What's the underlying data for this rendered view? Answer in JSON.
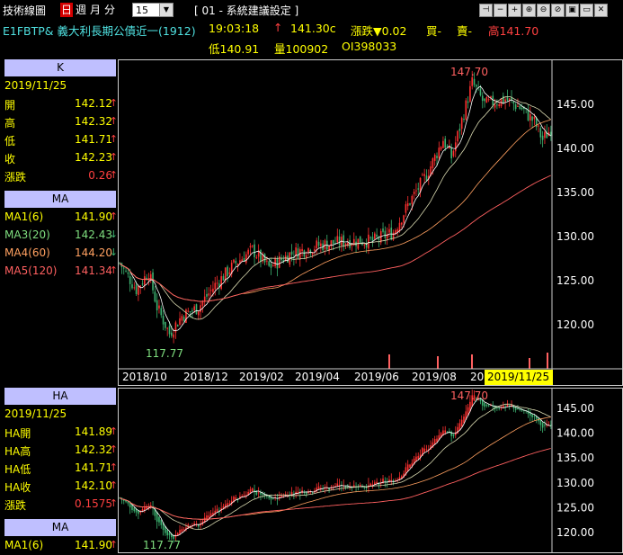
{
  "toolbar": {
    "title": "技術線圖",
    "tabs": [
      {
        "label": "日",
        "active": true
      },
      {
        "label": "週",
        "active": false
      },
      {
        "label": "月",
        "active": false
      },
      {
        "label": "分",
        "active": false
      }
    ],
    "interval": "15",
    "setting": "[ 01 - 系統建議設定 ]",
    "icons": [
      "pin-icon",
      "minus-icon",
      "plus-icon",
      "zoom-in-icon",
      "zoom-out-icon",
      "crosshair-icon",
      "save-icon",
      "window-icon",
      "close-icon"
    ]
  },
  "quote": {
    "symbol": "E1FBTP& 義大利長期公債近一(1912)",
    "time": "19:03:18",
    "arrow": "↑",
    "price": "141.30c",
    "change": "漲跌▼0.02",
    "buy": "買-",
    "sell": "賣-",
    "high": "高141.70",
    "low": "低140.91",
    "volume": "量100902",
    "oi": "OI398033"
  },
  "k_panel": {
    "header": "K",
    "date": "2019/11/25",
    "rows": [
      {
        "label": "開",
        "value": "142.12",
        "arrow": "↑"
      },
      {
        "label": "高",
        "value": "142.32",
        "arrow": "↑"
      },
      {
        "label": "低",
        "value": "141.71",
        "arrow": "↑"
      },
      {
        "label": "收",
        "value": "142.23",
        "arrow": "↑"
      },
      {
        "label": "漲跌",
        "value": "0.26",
        "arrow": "↑"
      }
    ],
    "ma_header": "MA",
    "ma_rows": [
      {
        "label": "MA1(6)",
        "value": "141.90",
        "arrow": "↑",
        "color": "#ffff00"
      },
      {
        "label": "MA3(20)",
        "value": "142.43",
        "arrow": "↓",
        "color": "#7fdf7f"
      },
      {
        "label": "MA4(60)",
        "value": "144.20",
        "arrow": "↓",
        "color": "#ffa060"
      },
      {
        "label": "MA5(120)",
        "value": "141.34",
        "arrow": "↑",
        "color": "#ff6060"
      }
    ]
  },
  "ha_panel": {
    "header": "HA",
    "date": "2019/11/25",
    "rows": [
      {
        "label": "HA開",
        "value": "141.89",
        "arrow": "↑"
      },
      {
        "label": "HA高",
        "value": "142.32",
        "arrow": "↑"
      },
      {
        "label": "HA低",
        "value": "141.71",
        "arrow": "↑"
      },
      {
        "label": "HA收",
        "value": "142.10",
        "arrow": "↑"
      },
      {
        "label": "漲跌",
        "value": "0.1575",
        "arrow": "↑"
      }
    ],
    "ma_header": "MA",
    "ma_rows": [
      {
        "label": "MA1(6)",
        "value": "141.90",
        "arrow": "↑",
        "color": "#ffff00"
      }
    ]
  },
  "chart_data": [
    {
      "type": "candlestick",
      "y_ticks": [
        "145.00",
        "140.00",
        "135.00",
        "130.00",
        "125.00",
        "120.00"
      ],
      "x_ticks": [
        "2018/10",
        "2018/12",
        "2019/02",
        "2019/04",
        "2019/06",
        "2019/08",
        "20"
      ],
      "highlight_date": "2019/11/25",
      "max_label": "147.70",
      "min_label": "117.77",
      "ylim": [
        115,
        150
      ]
    },
    {
      "type": "candlestick",
      "y_ticks": [
        "145.00",
        "140.00",
        "135.00",
        "130.00",
        "125.00",
        "120.00"
      ],
      "max_label": "147.70",
      "min_label": "117.77",
      "ylim": [
        116,
        149
      ]
    }
  ],
  "colors": {
    "up": "#ff3030",
    "down": "#3cb371",
    "header_bg": "#bfbfff",
    "label": "#ffff00",
    "cyan": "#4fe0e0"
  }
}
